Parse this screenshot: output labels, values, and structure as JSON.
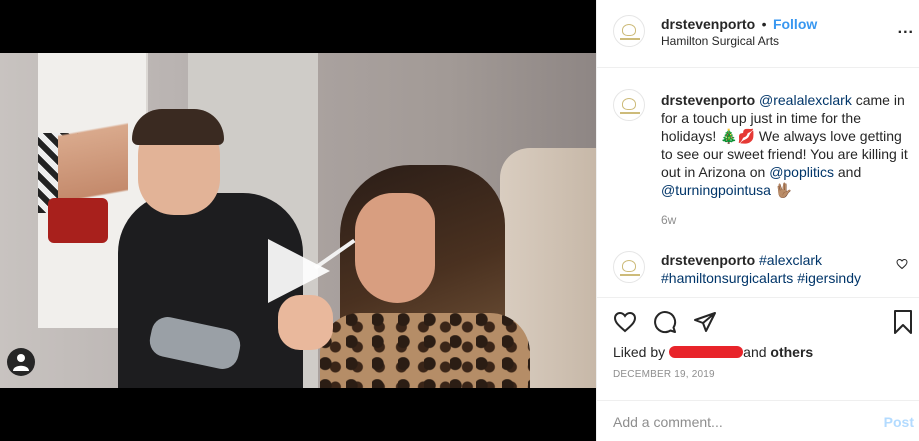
{
  "post": {
    "author": "drstevenporto",
    "separator": "•",
    "follow_label": "Follow",
    "location": "Hamilton Surgical Arts",
    "more_label": "..."
  },
  "caption": {
    "username": "drstevenporto",
    "mention1": "@realalexclark",
    "text1": " came in for a touch up just in time for the holidays! 🎄💋 We always love getting to see our sweet friend! You are killing it out in Arizona on ",
    "mention2": "@poplitics",
    "text2": " and ",
    "mention3": "@turningpointusa",
    "emoji_end": " 🖖🏽",
    "time_ago": "6w"
  },
  "comment": {
    "username": "drstevenporto",
    "hashtag1": "#alexclark",
    "hashtag2": "#hamiltonsurgicalarts",
    "hashtag3": "#igersindy"
  },
  "likes": {
    "prefix": "Liked by",
    "suffix_connector": "and",
    "others": "others"
  },
  "date": "DECEMBER 19, 2019",
  "add_comment": {
    "placeholder": "Add a comment...",
    "post_label": "Post"
  },
  "icons": {
    "play": "play-icon",
    "user_tags": "user-icon",
    "like": "heart-icon",
    "comment": "comment-icon",
    "share": "paper-plane-icon",
    "save": "bookmark-icon",
    "more": "ellipsis-icon"
  },
  "colors": {
    "link_blue": "#3897f0",
    "mention_blue": "#003569",
    "muted": "#8e8e8e",
    "redaction": "#e8242a",
    "post_disabled": "#b3dbff"
  }
}
